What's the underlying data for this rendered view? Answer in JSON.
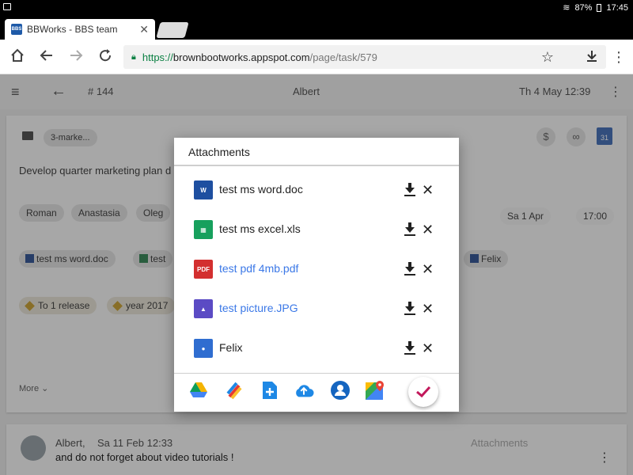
{
  "status_bar": {
    "battery": "87%",
    "time": "17:45"
  },
  "browser": {
    "tab_title": "BBWorks - BBS team",
    "favicon_text": "BBS",
    "url_scheme": "https://",
    "url_host": "brownbootworks.appspot.com",
    "url_path": "/page/task/579"
  },
  "app_header": {
    "task_number": "# 144",
    "user": "Albert",
    "date": "Th 4 May 12:39"
  },
  "task": {
    "folder_chip": "3-marke...",
    "title": "Develop quarter marketing plan d",
    "people": [
      "Roman",
      "Anastasia",
      "Oleg"
    ],
    "due_date": "Sa 1 Apr",
    "due_time": "17:00",
    "attachment_chips": [
      "test ms word.doc",
      "test",
      "Felix"
    ],
    "tags": [
      "To 1 release",
      "year 2017"
    ],
    "more_label": "More"
  },
  "comment": {
    "author": "Albert,",
    "date": "Sa 11 Feb 12:33",
    "text": "and do not forget about video tutorials !",
    "side_label": "Attachments"
  },
  "dialog": {
    "title": "Attachments",
    "items": [
      {
        "name": "test ms word.doc",
        "icon": "word-doc-icon",
        "icon_text": "W",
        "color": "#1e4fa0",
        "text_color": "#222222"
      },
      {
        "name": "test ms excel.xls",
        "icon": "excel-sheet-icon",
        "icon_text": "▦",
        "color": "#17a05d",
        "text_color": "#222222"
      },
      {
        "name": "test pdf 4mb.pdf",
        "icon": "pdf-icon",
        "icon_text": "PDF",
        "color": "#d32f2f",
        "text_color": "#3b78e7"
      },
      {
        "name": "test picture.JPG",
        "icon": "image-icon",
        "icon_text": "▲",
        "color": "#5b4bc4",
        "text_color": "#3b78e7"
      },
      {
        "name": "Felix",
        "icon": "contact-icon",
        "icon_text": "●",
        "color": "#2f6dd0",
        "text_color": "#222222"
      }
    ],
    "bottom_icons": [
      {
        "name": "google-drive-icon"
      },
      {
        "name": "attach-file-icon"
      },
      {
        "name": "add-file-icon"
      },
      {
        "name": "cloud-upload-icon"
      },
      {
        "name": "contact-circle-icon"
      },
      {
        "name": "google-maps-icon"
      }
    ]
  }
}
